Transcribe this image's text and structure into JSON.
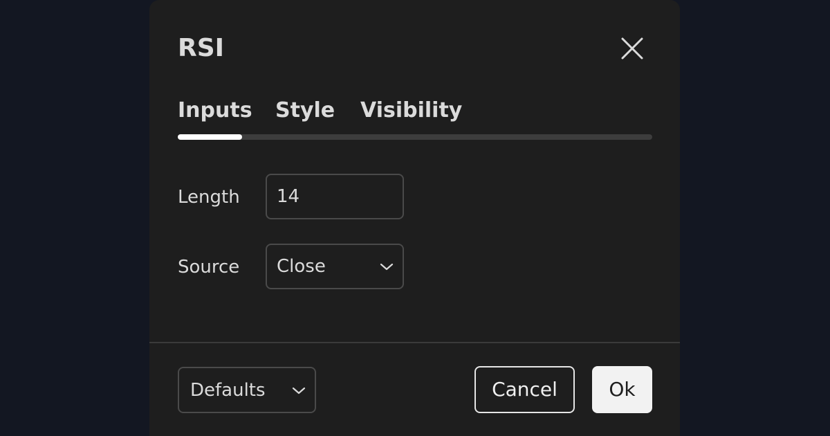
{
  "dialog": {
    "title": "RSI",
    "close_icon": "close-icon"
  },
  "tabs": [
    {
      "label": "Inputs",
      "active": true
    },
    {
      "label": "Style",
      "active": false
    },
    {
      "label": "Visibility",
      "active": false
    }
  ],
  "inputs": {
    "length": {
      "label": "Length",
      "value": "14"
    },
    "source": {
      "label": "Source",
      "value": "Close",
      "icon": "chevron-down-icon"
    }
  },
  "footer": {
    "defaults_label": "Defaults",
    "defaults_icon": "chevron-down-icon",
    "cancel_label": "Cancel",
    "ok_label": "Ok"
  },
  "colors": {
    "page_background": "#131722",
    "dialog_background": "#1e1e1e",
    "text": "#dbdbdb",
    "tab_indicator": "#ffffff",
    "tab_track": "#3d3d3d",
    "ok_button_background": "#f2f2f2"
  }
}
